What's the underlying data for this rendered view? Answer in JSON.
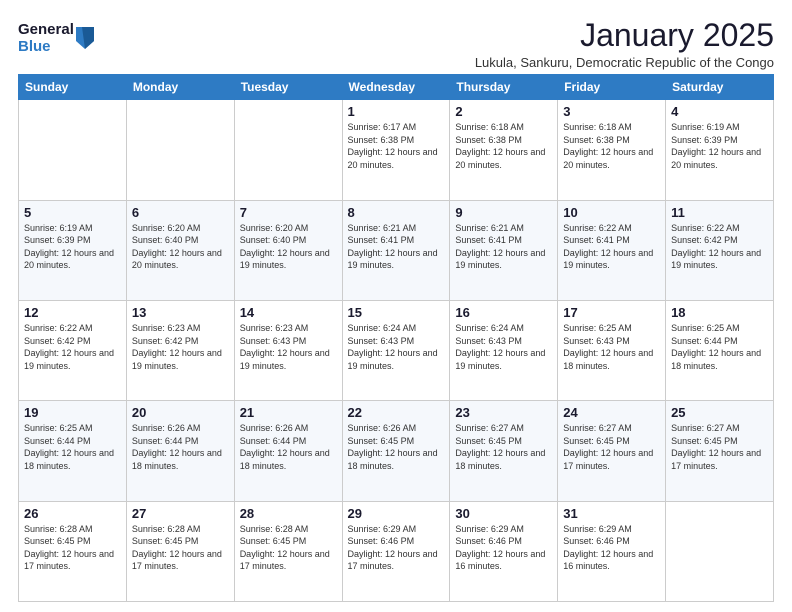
{
  "logo": {
    "general": "General",
    "blue": "Blue"
  },
  "title": "January 2025",
  "subtitle": "Lukula, Sankuru, Democratic Republic of the Congo",
  "days_of_week": [
    "Sunday",
    "Monday",
    "Tuesday",
    "Wednesday",
    "Thursday",
    "Friday",
    "Saturday"
  ],
  "weeks": [
    [
      {
        "day": "",
        "info": ""
      },
      {
        "day": "",
        "info": ""
      },
      {
        "day": "",
        "info": ""
      },
      {
        "day": "1",
        "info": "Sunrise: 6:17 AM\nSunset: 6:38 PM\nDaylight: 12 hours and 20 minutes."
      },
      {
        "day": "2",
        "info": "Sunrise: 6:18 AM\nSunset: 6:38 PM\nDaylight: 12 hours and 20 minutes."
      },
      {
        "day": "3",
        "info": "Sunrise: 6:18 AM\nSunset: 6:38 PM\nDaylight: 12 hours and 20 minutes."
      },
      {
        "day": "4",
        "info": "Sunrise: 6:19 AM\nSunset: 6:39 PM\nDaylight: 12 hours and 20 minutes."
      }
    ],
    [
      {
        "day": "5",
        "info": "Sunrise: 6:19 AM\nSunset: 6:39 PM\nDaylight: 12 hours and 20 minutes."
      },
      {
        "day": "6",
        "info": "Sunrise: 6:20 AM\nSunset: 6:40 PM\nDaylight: 12 hours and 20 minutes."
      },
      {
        "day": "7",
        "info": "Sunrise: 6:20 AM\nSunset: 6:40 PM\nDaylight: 12 hours and 19 minutes."
      },
      {
        "day": "8",
        "info": "Sunrise: 6:21 AM\nSunset: 6:41 PM\nDaylight: 12 hours and 19 minutes."
      },
      {
        "day": "9",
        "info": "Sunrise: 6:21 AM\nSunset: 6:41 PM\nDaylight: 12 hours and 19 minutes."
      },
      {
        "day": "10",
        "info": "Sunrise: 6:22 AM\nSunset: 6:41 PM\nDaylight: 12 hours and 19 minutes."
      },
      {
        "day": "11",
        "info": "Sunrise: 6:22 AM\nSunset: 6:42 PM\nDaylight: 12 hours and 19 minutes."
      }
    ],
    [
      {
        "day": "12",
        "info": "Sunrise: 6:22 AM\nSunset: 6:42 PM\nDaylight: 12 hours and 19 minutes."
      },
      {
        "day": "13",
        "info": "Sunrise: 6:23 AM\nSunset: 6:42 PM\nDaylight: 12 hours and 19 minutes."
      },
      {
        "day": "14",
        "info": "Sunrise: 6:23 AM\nSunset: 6:43 PM\nDaylight: 12 hours and 19 minutes."
      },
      {
        "day": "15",
        "info": "Sunrise: 6:24 AM\nSunset: 6:43 PM\nDaylight: 12 hours and 19 minutes."
      },
      {
        "day": "16",
        "info": "Sunrise: 6:24 AM\nSunset: 6:43 PM\nDaylight: 12 hours and 19 minutes."
      },
      {
        "day": "17",
        "info": "Sunrise: 6:25 AM\nSunset: 6:43 PM\nDaylight: 12 hours and 18 minutes."
      },
      {
        "day": "18",
        "info": "Sunrise: 6:25 AM\nSunset: 6:44 PM\nDaylight: 12 hours and 18 minutes."
      }
    ],
    [
      {
        "day": "19",
        "info": "Sunrise: 6:25 AM\nSunset: 6:44 PM\nDaylight: 12 hours and 18 minutes."
      },
      {
        "day": "20",
        "info": "Sunrise: 6:26 AM\nSunset: 6:44 PM\nDaylight: 12 hours and 18 minutes."
      },
      {
        "day": "21",
        "info": "Sunrise: 6:26 AM\nSunset: 6:44 PM\nDaylight: 12 hours and 18 minutes."
      },
      {
        "day": "22",
        "info": "Sunrise: 6:26 AM\nSunset: 6:45 PM\nDaylight: 12 hours and 18 minutes."
      },
      {
        "day": "23",
        "info": "Sunrise: 6:27 AM\nSunset: 6:45 PM\nDaylight: 12 hours and 18 minutes."
      },
      {
        "day": "24",
        "info": "Sunrise: 6:27 AM\nSunset: 6:45 PM\nDaylight: 12 hours and 17 minutes."
      },
      {
        "day": "25",
        "info": "Sunrise: 6:27 AM\nSunset: 6:45 PM\nDaylight: 12 hours and 17 minutes."
      }
    ],
    [
      {
        "day": "26",
        "info": "Sunrise: 6:28 AM\nSunset: 6:45 PM\nDaylight: 12 hours and 17 minutes."
      },
      {
        "day": "27",
        "info": "Sunrise: 6:28 AM\nSunset: 6:45 PM\nDaylight: 12 hours and 17 minutes."
      },
      {
        "day": "28",
        "info": "Sunrise: 6:28 AM\nSunset: 6:45 PM\nDaylight: 12 hours and 17 minutes."
      },
      {
        "day": "29",
        "info": "Sunrise: 6:29 AM\nSunset: 6:46 PM\nDaylight: 12 hours and 17 minutes."
      },
      {
        "day": "30",
        "info": "Sunrise: 6:29 AM\nSunset: 6:46 PM\nDaylight: 12 hours and 16 minutes."
      },
      {
        "day": "31",
        "info": "Sunrise: 6:29 AM\nSunset: 6:46 PM\nDaylight: 12 hours and 16 minutes."
      },
      {
        "day": "",
        "info": ""
      }
    ]
  ]
}
